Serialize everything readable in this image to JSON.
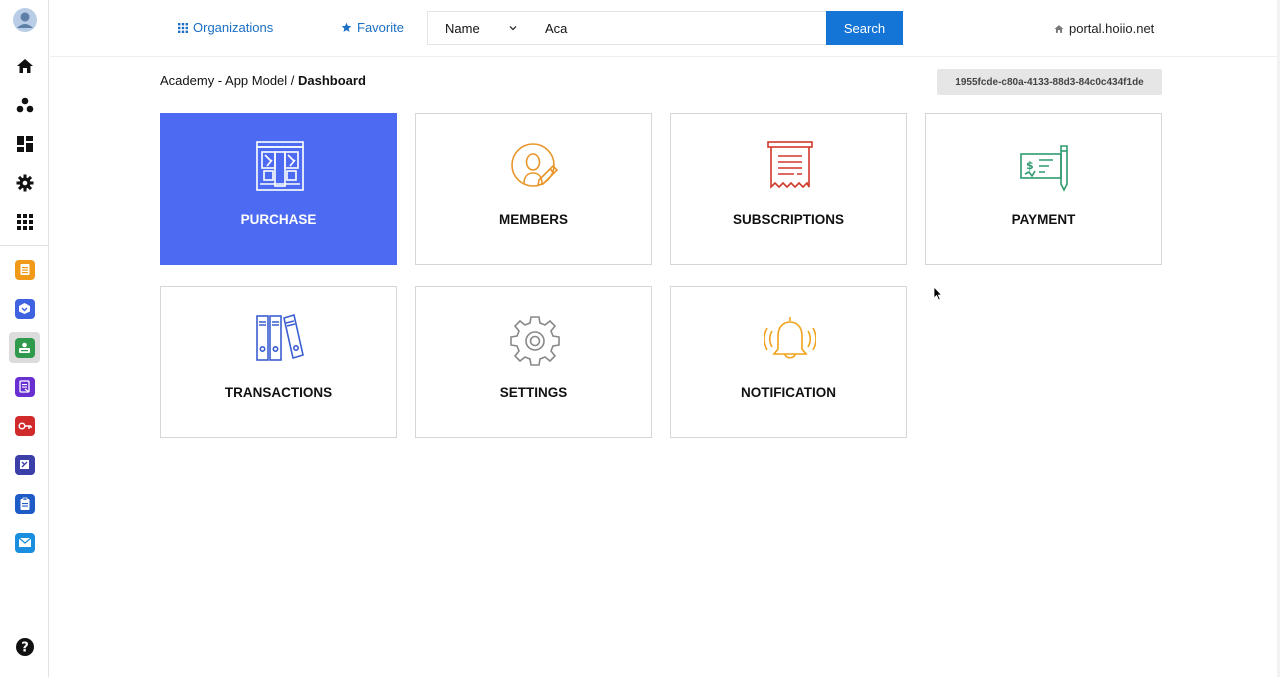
{
  "sidebar": {
    "items": [
      {
        "name": "avatar",
        "icon": "user-avatar-icon"
      },
      {
        "name": "sidebar-item-home",
        "icon": "home-icon"
      },
      {
        "name": "sidebar-item-groups",
        "icon": "group-icon"
      },
      {
        "name": "sidebar-item-dashboard",
        "icon": "dashboard-icon"
      },
      {
        "name": "sidebar-item-settings",
        "icon": "gear-icon"
      },
      {
        "name": "sidebar-item-apps",
        "icon": "grid-icon"
      }
    ],
    "apps": [
      {
        "icon": "notebook-icon",
        "color": "#f19a1a"
      },
      {
        "icon": "box-icon",
        "color": "#3f63e0"
      },
      {
        "icon": "academy-icon",
        "color": "#2f9a4c"
      },
      {
        "icon": "form-icon",
        "color": "#6a2fd1"
      },
      {
        "icon": "key-icon",
        "color": "#d12a2a"
      },
      {
        "icon": "puzzle-icon",
        "color": "#3d3fa8"
      },
      {
        "icon": "clipboard-icon",
        "color": "#1e5bc7"
      },
      {
        "icon": "mail-icon",
        "color": "#1a8fe0"
      }
    ],
    "help_icon": "help-icon"
  },
  "header": {
    "organizations_label": "Organizations",
    "favorite_label": "Favorite",
    "filter_value": "Name",
    "search_value": "Aca",
    "search_button": "Search",
    "portal_label": "portal.hoiio.net"
  },
  "breadcrumb": {
    "path": "Academy - App Model / ",
    "current": "Dashboard"
  },
  "record_id": "1955fcde-c80a-4133-88d3-84c0c434f1de",
  "tiles": [
    {
      "label": "PURCHASE",
      "icon": "building-icon",
      "color": "#ffffff",
      "active": true
    },
    {
      "label": "MEMBERS",
      "icon": "member-edit-icon",
      "color": "#e8962a",
      "active": false
    },
    {
      "label": "SUBSCRIPTIONS",
      "icon": "receipt-icon",
      "color": "#d0382b",
      "active": false
    },
    {
      "label": "PAYMENT",
      "icon": "cheque-icon",
      "color": "#2e9a6e",
      "active": false
    },
    {
      "label": "TRANSACTIONS",
      "icon": "binders-icon",
      "color": "#3b5fd1",
      "active": false
    },
    {
      "label": "SETTINGS",
      "icon": "gear-icon",
      "color": "#888888",
      "active": false
    },
    {
      "label": "NOTIFICATION",
      "icon": "bell-icon",
      "color": "#f0a21a",
      "active": false
    }
  ],
  "colors": {
    "accent": "#1475d6",
    "link": "#1a6fc4",
    "active_tile": "#4d6bf2"
  }
}
